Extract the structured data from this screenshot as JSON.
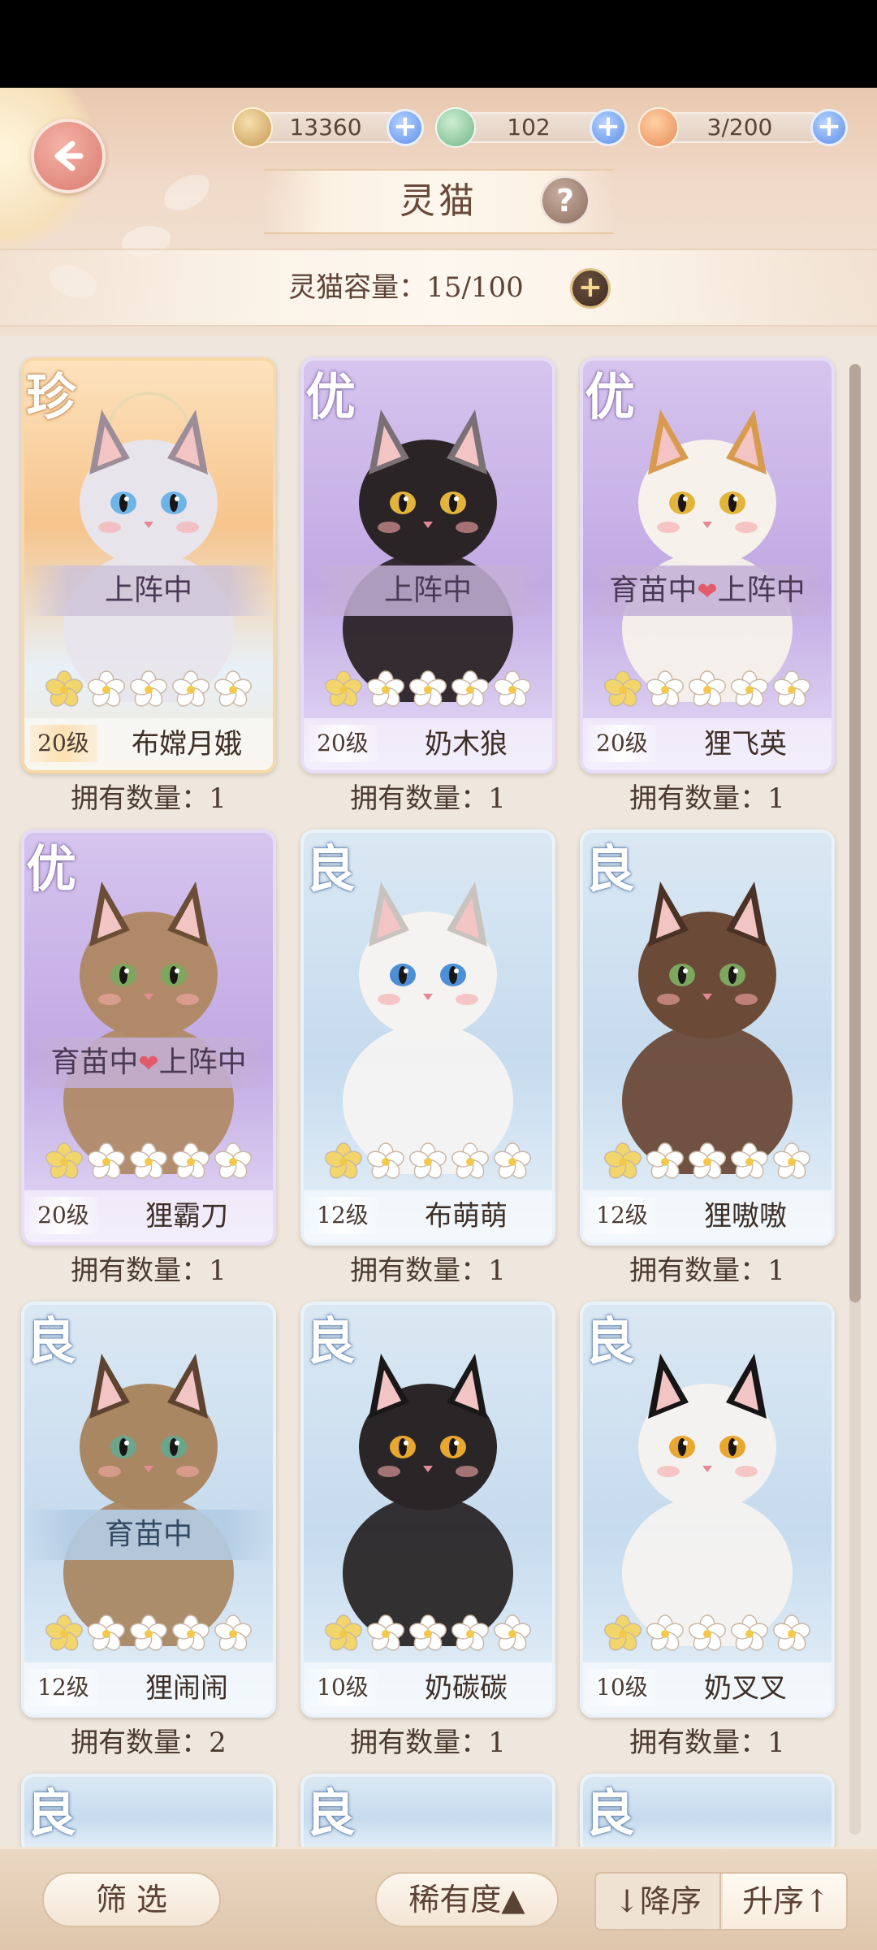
{
  "header": {
    "title": "灵猫",
    "help_label": "?",
    "back_label": "back",
    "resources": [
      {
        "icon": "paw-coin-icon",
        "value": "13360"
      },
      {
        "icon": "fish-treat-icon",
        "value": "102"
      },
      {
        "icon": "cat-food-icon",
        "value": "3/200"
      }
    ],
    "capacity": "灵猫容量：15/100"
  },
  "cards": [
    {
      "rarity": "珍",
      "tier": "rare",
      "status": "上阵中",
      "level": "20级",
      "name": "布嫦月娥",
      "stars": 1,
      "owned": "拥有数量：1"
    },
    {
      "rarity": "优",
      "tier": "excellent",
      "status": "上阵中",
      "level": "20级",
      "name": "奶木狼",
      "stars": 1,
      "owned": "拥有数量：1"
    },
    {
      "rarity": "优",
      "tier": "excellent",
      "status_a": "育苗中",
      "status_b": "上阵中",
      "level": "20级",
      "name": "狸飞英",
      "stars": 1,
      "owned": "拥有数量：1"
    },
    {
      "rarity": "优",
      "tier": "excellent",
      "status_a": "育苗中",
      "status_b": "上阵中",
      "level": "20级",
      "name": "狸霸刀",
      "stars": 1,
      "owned": "拥有数量：1"
    },
    {
      "rarity": "良",
      "tier": "good",
      "level": "12级",
      "name": "布萌萌",
      "stars": 1,
      "owned": "拥有数量：1"
    },
    {
      "rarity": "良",
      "tier": "good",
      "level": "12级",
      "name": "狸嗷嗷",
      "stars": 1,
      "owned": "拥有数量：1"
    },
    {
      "rarity": "良",
      "tier": "good",
      "status": "育苗中",
      "level": "12级",
      "name": "狸闹闹",
      "stars": 1,
      "owned": "拥有数量：2"
    },
    {
      "rarity": "良",
      "tier": "good",
      "level": "10级",
      "name": "奶碳碳",
      "stars": 1,
      "owned": "拥有数量：1"
    },
    {
      "rarity": "良",
      "tier": "good",
      "level": "10级",
      "name": "奶叉叉",
      "stars": 1,
      "owned": "拥有数量：1"
    },
    {
      "rarity": "良",
      "tier": "good"
    },
    {
      "rarity": "良",
      "tier": "good"
    },
    {
      "rarity": "良",
      "tier": "good"
    }
  ],
  "footer": {
    "filter_label": "筛 选",
    "rarity_sort_label": "稀有度▲",
    "desc_label": "↓降序",
    "asc_label": "升序↑"
  },
  "colors": {
    "star_filled": "#f3d66b",
    "star_empty": "#ffffff",
    "plus_blue": "#5d8fe6"
  }
}
